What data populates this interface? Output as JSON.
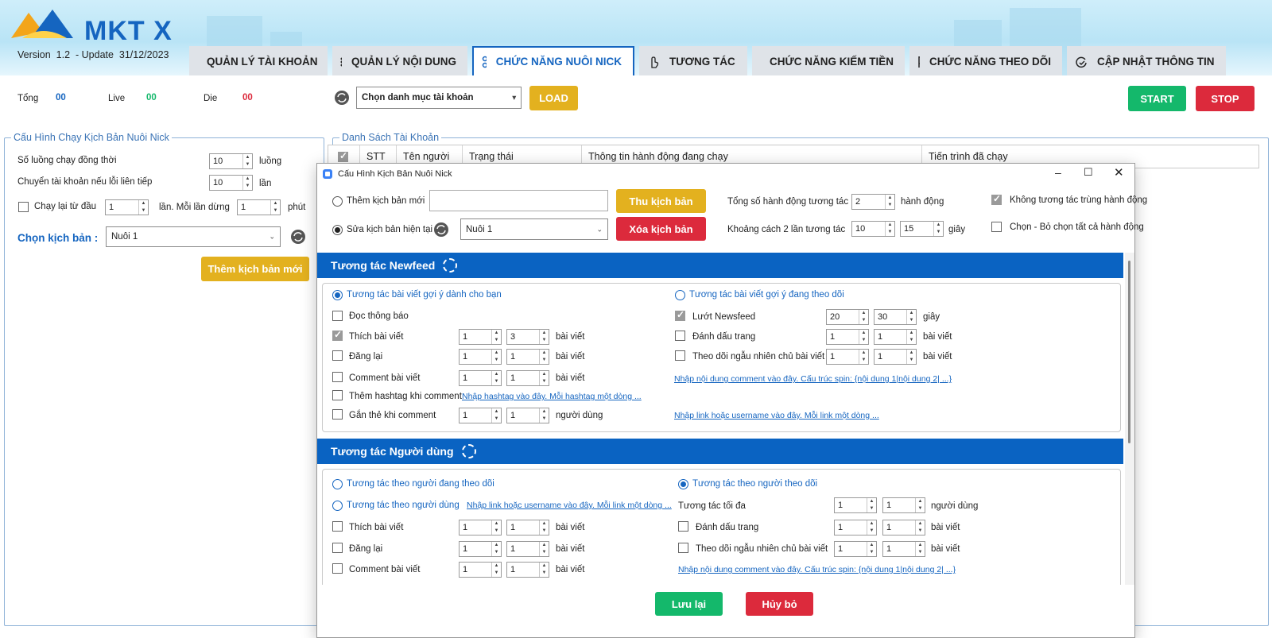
{
  "app": {
    "logo_text": "MKT X",
    "version_label": "Version",
    "version": "1.2",
    "update_label": "- Update",
    "update_date": "31/12/2023"
  },
  "tabs": [
    {
      "label": "QUẢN LÝ TÀI KHOẢN",
      "icon": "account-list-icon"
    },
    {
      "label": "QUẢN LÝ NỘI DUNG",
      "icon": "content-list-icon"
    },
    {
      "label": "CHỨC NĂNG NUÔI NICK",
      "icon": "nodes-icon"
    },
    {
      "label": "TƯƠNG TÁC",
      "icon": "hand-pointer-icon"
    },
    {
      "label": "CHỨC NĂNG KIẾM TIỀN",
      "icon": "money-window-icon"
    },
    {
      "label": "CHỨC NĂNG THEO DÕI",
      "icon": "flag-icon"
    },
    {
      "label": "CẬP NHẬT THÔNG TIN",
      "icon": "refresh-check-icon"
    }
  ],
  "stats": {
    "total_label": "Tổng",
    "total": "00",
    "live_label": "Live",
    "live": "00",
    "die_label": "Die",
    "die": "00"
  },
  "toolbar": {
    "category_select": "Chọn danh mục tài khoản",
    "load": "LOAD",
    "start": "START",
    "stop": "STOP"
  },
  "colors": {
    "accent": "#1565c0",
    "green": "#14b86b",
    "red": "#dc2a3c",
    "yellow": "#e3b11f"
  },
  "left_panel": {
    "legend": "Cấu Hình Chạy Kịch Bản Nuôi Nick",
    "threads_label": "Số luồng chạy đồng thời",
    "threads": "10",
    "threads_unit": "luồng",
    "switch_label": "Chuyển tài khoản nếu lỗi liên tiếp",
    "switch": "10",
    "switch_unit": "lần",
    "restart_label": "Chạy lại từ đầu",
    "restart": "1",
    "restart_mid": "lần. Mỗi lần dừng",
    "restart_wait": "1",
    "restart_unit": "phút",
    "choose_label": "Chọn kịch bản :",
    "choose_value": "Nuôi 1",
    "add_button": "Thêm kịch bản mới"
  },
  "accounts": {
    "legend": "Danh Sách Tài Khoản",
    "columns": [
      "STT",
      "Tên người",
      "Trạng thái",
      "Thông tin hành động đang chạy",
      "Tiến trình đã chạy"
    ]
  },
  "dialog": {
    "title": "Cấu Hình Kịch Bản Nuôi Nick",
    "new_label": "Thêm kịch bản mới",
    "new_value": "",
    "edit_label": "Sửa kịch bản hiện tại",
    "edit_value": "Nuôi 1",
    "collapse_btn": "Thu kịch bản",
    "delete_btn": "Xóa kịch bản",
    "total_label": "Tổng số hành động tương tác",
    "total_value": "2",
    "total_unit": "hành động",
    "gap_label": "Khoảng cách 2 lần tương tác",
    "gap_min": "10",
    "gap_max": "15",
    "gap_unit": "giây",
    "no_dup_label": "Không tương tác trùng hành động",
    "select_all_label": "Chọn - Bỏ chọn tất cả hành động",
    "save": "Lưu lại",
    "cancel": "Hủy bỏ"
  },
  "newfeed": {
    "title": "Tương tác Newfeed",
    "opt_left": "Tương tác bài viết gợi ý dành cho bạn",
    "opt_right": "Tương tác bài viết gợi ý đang theo dõi",
    "rows_left": [
      {
        "label": "Đọc thông báo"
      },
      {
        "label": "Thích bài viết",
        "a": "1",
        "b": "3",
        "unit": "bài viết"
      },
      {
        "label": "Đăng lại",
        "a": "1",
        "b": "1",
        "unit": "bài viết"
      },
      {
        "label": "Comment bài viết",
        "a": "1",
        "b": "1",
        "unit": "bài viết"
      },
      {
        "label": "Thêm hashtag khi comment",
        "link": "Nhập hashtag vào đây. Mỗi hashtag một dòng ..."
      },
      {
        "label": "Gắn thẻ khi comment",
        "a": "1",
        "b": "1",
        "unit": "người dùng"
      }
    ],
    "rows_right": [
      {
        "label": "Lướt Newsfeed",
        "a": "20",
        "b": "30",
        "unit": "giây"
      },
      {
        "label": "Đánh dấu trang",
        "a": "1",
        "b": "1",
        "unit": "bài viết"
      },
      {
        "label": "Theo dõi ngẫu nhiên chủ bài viết",
        "a": "1",
        "b": "1",
        "unit": "bài viết"
      }
    ],
    "comment_link": "Nhập nội dung comment vào đây. Cấu trúc spin: {nội dung 1|nội dung 2| ...}",
    "tag_link": "Nhập link hoặc username vào đây. Mỗi link một dòng ..."
  },
  "users": {
    "title": "Tương tác Người dùng",
    "opt_following": "Tương tác theo người đang theo dõi",
    "opt_user": "Tương tác theo người dùng",
    "opt_user_link": "Nhập link hoặc username vào đây. Mỗi link một dòng ...",
    "opt_followers": "Tương tác theo người theo dõi",
    "max_label": "Tương tác tối đa",
    "max_a": "1",
    "max_b": "1",
    "max_unit": "người dùng",
    "rows_left": [
      {
        "label": "Thích bài viết",
        "a": "1",
        "b": "1",
        "unit": "bài viết"
      },
      {
        "label": "Đăng lại",
        "a": "1",
        "b": "1",
        "unit": "bài viết"
      },
      {
        "label": "Comment bài viết",
        "a": "1",
        "b": "1",
        "unit": "bài viết"
      }
    ],
    "rows_right": [
      {
        "label": "Đánh dấu trang",
        "a": "1",
        "b": "1",
        "unit": "bài viết"
      },
      {
        "label": "Theo dõi ngẫu nhiên chủ bài viết",
        "a": "1",
        "b": "1",
        "unit": "bài viết"
      }
    ],
    "comment_link": "Nhập nội dung comment vào đây. Cấu trúc spin: {nội dung 1|nội dung 2| ...}"
  }
}
